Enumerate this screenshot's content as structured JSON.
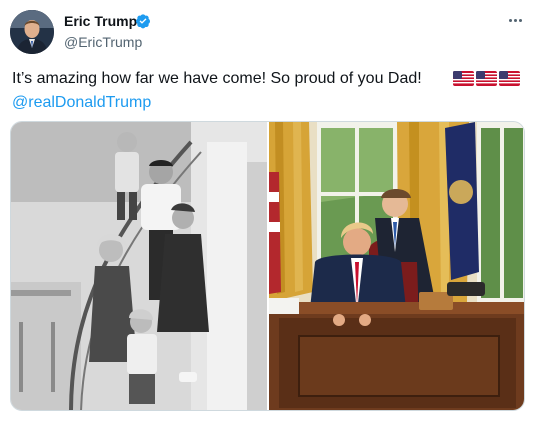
{
  "author": {
    "name": "Eric Trump",
    "handle": "@EricTrump",
    "verified": true,
    "avatar_icon": "profile-photo"
  },
  "tweet": {
    "text": "It’s amazing how far we have come! So proud of you Dad!",
    "flags": [
      "us-flag-emoji",
      "us-flag-emoji",
      "us-flag-emoji"
    ],
    "mention": "@realDonaldTrump"
  },
  "media": {
    "count": 2,
    "photos": [
      {
        "name": "family-staircase-photo",
        "style": "black-and-white"
      },
      {
        "name": "oval-office-photo",
        "style": "color"
      }
    ]
  },
  "colors": {
    "link": "#1d9bf0",
    "text": "#0f1419",
    "secondary": "#536471",
    "verified": "#1d9bf0",
    "border": "#cfd9de"
  },
  "icons": {
    "verified": "verified-badge-icon",
    "more": "more-options-icon"
  }
}
